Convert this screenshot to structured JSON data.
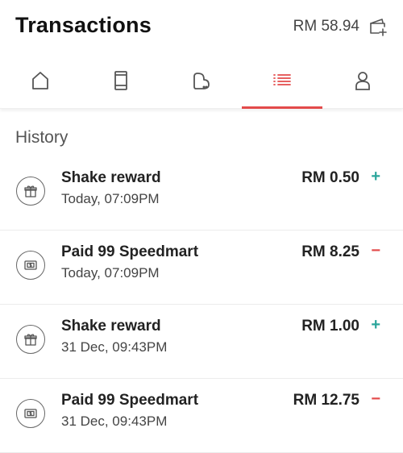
{
  "header": {
    "title": "Transactions",
    "balance": "RM 58.94",
    "wallet_icon": "wallet-add-icon"
  },
  "tabs": [
    {
      "name": "home",
      "icon": "home-icon",
      "active": false
    },
    {
      "name": "mobile",
      "icon": "mobile-icon",
      "active": false
    },
    {
      "name": "deals",
      "icon": "bag-icon",
      "active": false
    },
    {
      "name": "transactions",
      "icon": "list-icon",
      "active": true
    },
    {
      "name": "profile",
      "icon": "person-icon",
      "active": false
    }
  ],
  "section_title": "History",
  "transactions": [
    {
      "name": "Shake reward",
      "time": "Today, 07:09PM",
      "amount": "RM 0.50",
      "sign": "+",
      "icon": "gift-icon"
    },
    {
      "name": "Paid 99 Speedmart",
      "time": "Today, 07:09PM",
      "amount": "RM 8.25",
      "sign": "−",
      "icon": "payment-icon"
    },
    {
      "name": "Shake reward",
      "time": "31 Dec, 09:43PM",
      "amount": "RM 1.00",
      "sign": "+",
      "icon": "gift-icon"
    },
    {
      "name": "Paid 99 Speedmart",
      "time": "31 Dec, 09:43PM",
      "amount": "RM 12.75",
      "sign": "−",
      "icon": "payment-icon"
    }
  ],
  "colors": {
    "accent": "#e34b4b",
    "plus": "#2aa59b",
    "minus": "#e34b4b"
  }
}
